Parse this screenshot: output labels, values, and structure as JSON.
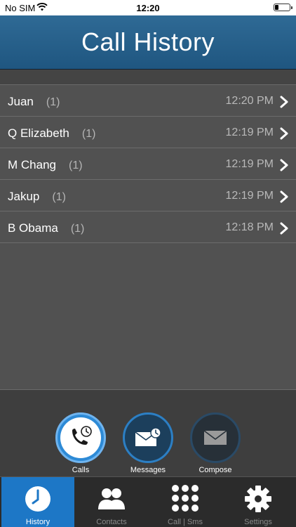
{
  "status_bar": {
    "carrier": "No SIM",
    "time": "12:20"
  },
  "header": {
    "title": "Call History"
  },
  "call_list": [
    {
      "name": "Juan",
      "count": "(1)",
      "time": "12:20 PM"
    },
    {
      "name": "Q Elizabeth",
      "count": "(1)",
      "time": "12:19 PM"
    },
    {
      "name": "M Chang",
      "count": "(1)",
      "time": "12:19 PM"
    },
    {
      "name": "Jakup",
      "count": "(1)",
      "time": "12:19 PM"
    },
    {
      "name": "B Obama",
      "count": "(1)",
      "time": "12:18 PM"
    }
  ],
  "actions": {
    "calls": "Calls",
    "messages": "Messages",
    "compose": "Compose"
  },
  "tabs": {
    "history": "History",
    "contacts": "Contacts",
    "call_sms": "Call | Sms",
    "settings": "Settings"
  },
  "colors": {
    "header": "#1f5680",
    "accent": "#1d77c6",
    "list_bg": "#515151"
  },
  "icons": {
    "wifi": "wifi-icon",
    "battery": "battery-icon",
    "chevron": "chevron-right-icon",
    "calls": "phone-clock-icon",
    "messages": "envelope-clock-icon",
    "compose": "envelope-icon",
    "history": "clock-icon",
    "contacts": "people-icon",
    "call_sms": "dialpad-icon",
    "settings": "gear-icon"
  }
}
